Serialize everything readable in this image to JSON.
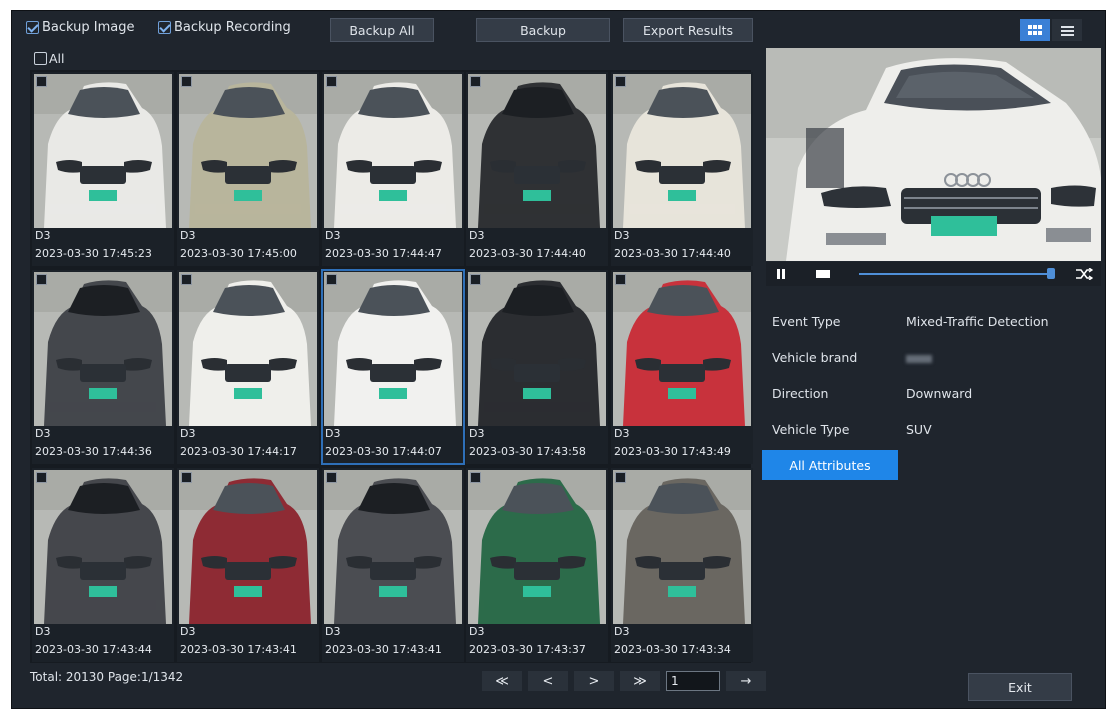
{
  "toolbar": {
    "backup_image_label": "Backup Image",
    "backup_recording_label": "Backup Recording",
    "backup_all_label": "Backup All",
    "backup_label": "Backup",
    "export_results_label": "Export Results"
  },
  "select_all_label": "All",
  "results": [
    {
      "camera": "D3",
      "time": "2023-03-30 17:45:23",
      "color": "#e9e9e6"
    },
    {
      "camera": "D3",
      "time": "2023-03-30 17:45:00",
      "color": "#b8b59c"
    },
    {
      "camera": "D3",
      "time": "2023-03-30 17:44:47",
      "color": "#ecebe7"
    },
    {
      "camera": "D3",
      "time": "2023-03-30 17:44:40",
      "color": "#2f3134"
    },
    {
      "camera": "D3",
      "time": "2023-03-30 17:44:40",
      "color": "#e7e4da"
    },
    {
      "camera": "D3",
      "time": "2023-03-30 17:44:36",
      "color": "#44474c"
    },
    {
      "camera": "D3",
      "time": "2023-03-30 17:44:17",
      "color": "#efefeb"
    },
    {
      "camera": "D3",
      "time": "2023-03-30 17:44:07",
      "color": "#f1f1ef",
      "selected": true
    },
    {
      "camera": "D3",
      "time": "2023-03-30 17:43:58",
      "color": "#2b2d31"
    },
    {
      "camera": "D3",
      "time": "2023-03-30 17:43:49",
      "color": "#c8323c"
    },
    {
      "camera": "D3",
      "time": "2023-03-30 17:43:44",
      "color": "#45474c"
    },
    {
      "camera": "D3",
      "time": "2023-03-30 17:43:41",
      "color": "#8e2b34"
    },
    {
      "camera": "D3",
      "time": "2023-03-30 17:43:41",
      "color": "#4b4d52"
    },
    {
      "camera": "D3",
      "time": "2023-03-30 17:43:37",
      "color": "#2c6b4a"
    },
    {
      "camera": "D3",
      "time": "2023-03-30 17:43:34",
      "color": "#6a6761"
    }
  ],
  "footer": {
    "total_text": "Total: 20130  Page:1/1342",
    "page_value": "1",
    "first_label": "≪",
    "prev_label": "<",
    "next_label": ">",
    "last_label": "≫",
    "go_label": "→"
  },
  "exit_label": "Exit",
  "view_toggle": {
    "active": "grid",
    "icons": [
      "grid-icon",
      "list-icon"
    ]
  },
  "player": {
    "progress": 0.98,
    "icons": [
      "pause-icon",
      "stop-icon",
      "clip-icon"
    ]
  },
  "attributes": [
    {
      "label": "Event Type",
      "value": "Mixed-Traffic Detection"
    },
    {
      "label": "Vehicle brand",
      "value": ""
    },
    {
      "label": "Direction",
      "value": "Downward"
    },
    {
      "label": "Vehicle Type",
      "value": "SUV"
    }
  ],
  "all_attributes_label": "All Attributes",
  "colors": {
    "accent": "#1f86e8",
    "panel": "#1f252d",
    "selection": "#2e6fb8"
  }
}
